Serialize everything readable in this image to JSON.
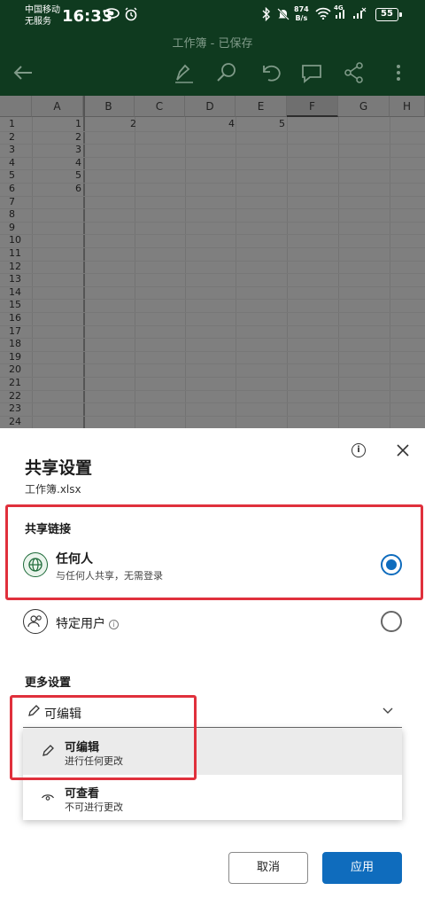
{
  "status_bar": {
    "carrier_line1": "中国移动",
    "carrier_line2": "无服务",
    "time": "16:33",
    "net_speed_value": "874",
    "net_speed_unit": "B/s",
    "signal_label": "4G",
    "battery": "55"
  },
  "app": {
    "title": "工作簿 - 已保存"
  },
  "sheet": {
    "columns": [
      "A",
      "B",
      "C",
      "D",
      "E",
      "F",
      "G",
      "H"
    ],
    "selected_column": "F",
    "rows": [
      "1",
      "2",
      "3",
      "4",
      "5",
      "6",
      "7",
      "8",
      "9",
      "10",
      "11",
      "12",
      "13",
      "14",
      "15",
      "16",
      "17",
      "18",
      "19",
      "20",
      "21",
      "22",
      "23",
      "24"
    ],
    "cells": {
      "A1": "1",
      "A2": "2",
      "A3": "3",
      "A4": "4",
      "A5": "5",
      "A6": "6",
      "B1": "2",
      "D1": "4",
      "E1": "5"
    }
  },
  "share": {
    "title": "共享设置",
    "filename": "工作簿.xlsx",
    "link_section": "共享链接",
    "options": [
      {
        "title": "任何人",
        "description": "与任何人共享，无需登录",
        "selected": true,
        "icon": "globe-icon"
      },
      {
        "title": "特定用户",
        "selected": false,
        "icon": "people-icon"
      }
    ],
    "more_section": "更多设置",
    "permission": {
      "value": "可编辑",
      "items": [
        {
          "title": "可编辑",
          "description": "进行任何更改",
          "icon": "pencil-icon",
          "selected": true
        },
        {
          "title": "可查看",
          "description": "不可进行更改",
          "icon": "eye-icon",
          "selected": false
        }
      ]
    },
    "cancel_label": "取消",
    "apply_label": "应用"
  },
  "colors": {
    "header_bg": "#0f3a1f",
    "accent": "#0f6cbd",
    "highlight": "#e0303c"
  }
}
